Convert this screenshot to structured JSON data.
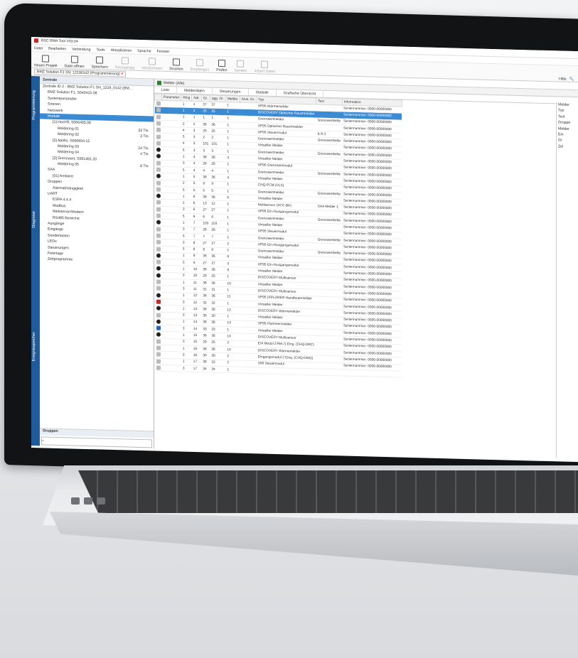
{
  "app": {
    "title": "BSC BMA Tool V03.04"
  },
  "menu": [
    "Datei",
    "Bearbeiten",
    "Verbindung",
    "Tools",
    "Aktualisieren",
    "Sprache",
    "Fenster"
  ],
  "toolbar": [
    {
      "label": "Neues Projekt",
      "enabled": true
    },
    {
      "label": "Datei öffnen",
      "enabled": true
    },
    {
      "label": "Speichern",
      "enabled": true
    },
    {
      "label": "Rückgängig",
      "enabled": false
    },
    {
      "label": "Wiederholen",
      "enabled": false
    },
    {
      "label": "Drucken",
      "enabled": true
    },
    {
      "label": "Empfangen",
      "enabled": false
    },
    {
      "label": "Prüfen",
      "enabled": true
    },
    {
      "label": "Senden",
      "enabled": false
    },
    {
      "label": "Import Daten",
      "enabled": false
    }
  ],
  "toolbar_right": {
    "help_label": "Hilfe",
    "search_icon": "search-icon"
  },
  "project_tab": {
    "label": "BMZ Solution F1 SN: 12190142 (Programmierung)"
  },
  "side_tabs": [
    "Programmierung",
    "Diagnose",
    "Ereignisspeicher"
  ],
  "tree": {
    "header": "Zentrale",
    "nodes": [
      {
        "label": "Zentrale ID 2 - BMZ Solution F1 SN_1219_0142 (BM...",
        "indent": 0,
        "count": ""
      },
      {
        "label": "BMZ Solution F1, S040415.08",
        "indent": 1,
        "count": ""
      },
      {
        "label": "Systemparameter",
        "indent": 1,
        "count": ""
      },
      {
        "label": "Sirenen",
        "indent": 1,
        "count": ""
      },
      {
        "label": "Netzwerk",
        "indent": 1,
        "count": ""
      },
      {
        "label": "Module",
        "indent": 1,
        "count": "",
        "selected": true
      },
      {
        "label": "[1] Hochfil, S066405.08",
        "indent": 2,
        "count": ""
      },
      {
        "label": "Meldering 01",
        "indent": 3,
        "count": "33 Tln."
      },
      {
        "label": "Meldering 02",
        "indent": 3,
        "count": "3 Tln."
      },
      {
        "label": "[2] Apollo, S060604.15",
        "indent": 2,
        "count": ""
      },
      {
        "label": "Meldering 03",
        "indent": 3,
        "count": "24 Tln."
      },
      {
        "label": "Meldering 04",
        "indent": 3,
        "count": "4 Tln."
      },
      {
        "label": "[3] Grenzwert, S061481.20",
        "indent": 2,
        "count": ""
      },
      {
        "label": "Meldering 05",
        "indent": 3,
        "count": "8 Tln."
      },
      {
        "label": "SAA",
        "indent": 1,
        "count": ""
      },
      {
        "label": "[01] Ambient",
        "indent": 2,
        "count": ""
      },
      {
        "label": "Gruppen",
        "indent": 1,
        "count": ""
      },
      {
        "label": "Alarmabhängigkeit",
        "indent": 2,
        "count": ""
      },
      {
        "label": "UART",
        "indent": 1,
        "count": ""
      },
      {
        "label": "ESPA 4.4.4",
        "indent": 2,
        "count": ""
      },
      {
        "label": "Modbus",
        "indent": 2,
        "count": ""
      },
      {
        "label": "Webserver/Modem",
        "indent": 2,
        "count": ""
      },
      {
        "label": "RS485 Bereiche",
        "indent": 2,
        "count": ""
      },
      {
        "label": "Ausgänge",
        "indent": 1,
        "count": ""
      },
      {
        "label": "Eingänge",
        "indent": 1,
        "count": ""
      },
      {
        "label": "Sondertasten",
        "indent": 1,
        "count": ""
      },
      {
        "label": "LEDs",
        "indent": 1,
        "count": ""
      },
      {
        "label": "Steuerungen",
        "indent": 1,
        "count": ""
      },
      {
        "label": "Feiertage",
        "indent": 1,
        "count": ""
      },
      {
        "label": "Zeitprogramme",
        "indent": 1,
        "count": ""
      }
    ],
    "footer": "Gruppen"
  },
  "grid": {
    "title": "Melder (Alle)",
    "tabs": [
      "Liste",
      "Melderdaten",
      "Steuerungen",
      "Statistik",
      "Grafische Übersicht"
    ],
    "columns": [
      "Parameter",
      "Ring",
      "Adr.",
      "Gr.",
      "agg. Gr.",
      "Melder",
      "Anst. Gr.",
      "Typ",
      "Text",
      "Information"
    ],
    "rows": [
      {
        "icon": "grey",
        "ring": "1",
        "adr": "1",
        "gr": "37",
        "agg": "37",
        "melder": "1",
        "anst": "",
        "typ": "XP95 Wärmemelder",
        "text": "",
        "info": "Seriennummer: 0000-00000000"
      },
      {
        "icon": "grey",
        "ring": "1",
        "adr": "2",
        "gr": "25",
        "agg": "25",
        "melder": "1",
        "anst": "",
        "typ": "DISCOVERY Optischer Rauchmelder",
        "text": "",
        "info": "Seriennummer: 0000-00000000",
        "selected": true
      },
      {
        "icon": "grey",
        "ring": "1",
        "adr": "1",
        "gr": "1",
        "agg": "1",
        "melder": "1",
        "anst": "",
        "typ": "Grenzwertmelder",
        "text": "Grenzwertkette",
        "info": "Seriennummer: 0000-00000000"
      },
      {
        "icon": "grey",
        "ring": "2",
        "adr": "2",
        "gr": "36",
        "agg": "36",
        "melder": "1",
        "anst": "",
        "typ": "XP95 Optischer Rauchmelder",
        "text": "",
        "info": "Seriennummer: 0000-00000000"
      },
      {
        "icon": "grey",
        "ring": "4",
        "adr": "3",
        "gr": "25",
        "agg": "25",
        "melder": "1",
        "anst": "",
        "typ": "XP95 Steuermodul",
        "text": "& N 2",
        "info": "Seriennummer: 0000-00000000"
      },
      {
        "icon": "grey",
        "ring": "5",
        "adr": "3",
        "gr": "2",
        "agg": "2",
        "melder": "1",
        "anst": "",
        "typ": "Grenzwertmelder",
        "text": "Grenzwertkette",
        "info": "Seriennummer: 0000-00000000"
      },
      {
        "icon": "grey",
        "ring": "4",
        "adr": "3",
        "gr": "101",
        "agg": "101",
        "melder": "1",
        "anst": "",
        "typ": "Virtueller Melder",
        "text": "",
        "info": "Seriennummer: 0000-00000000"
      },
      {
        "icon": "black",
        "ring": "5",
        "adr": "3",
        "gr": "3",
        "agg": "3",
        "melder": "1",
        "anst": "",
        "typ": "Grenzwertmelder",
        "text": "Grenzwertkette",
        "info": "Seriennummer: 0000-00000000"
      },
      {
        "icon": "black",
        "ring": "1",
        "adr": "4",
        "gr": "36",
        "agg": "36",
        "melder": "3",
        "anst": "",
        "typ": "Virtueller Melder",
        "text": "",
        "info": "Seriennummer: 0000-00000000"
      },
      {
        "icon": "grey",
        "ring": "3",
        "adr": "4",
        "gr": "26",
        "agg": "26",
        "melder": "1",
        "anst": "",
        "typ": "XP95 Grenzwertmodul",
        "text": "",
        "info": "Seriennummer: 0000-00000000"
      },
      {
        "icon": "grey",
        "ring": "5",
        "adr": "4",
        "gr": "4",
        "agg": "4",
        "melder": "1",
        "anst": "",
        "typ": "Grenzwertmelder",
        "text": "Grenzwertkette",
        "info": "Seriennummer: 0000-00000000"
      },
      {
        "icon": "black",
        "ring": "1",
        "adr": "5",
        "gr": "36",
        "agg": "36",
        "melder": "4",
        "anst": "",
        "typ": "Virtueller Melder",
        "text": "",
        "info": "Seriennummer: 0000-00000000"
      },
      {
        "icon": "grey",
        "ring": "2",
        "adr": "5",
        "gr": "9",
        "agg": "9",
        "melder": "1",
        "anst": "",
        "typ": "CHQ-PCM (VLS)",
        "text": "",
        "info": "Seriennummer: 0000-00000000"
      },
      {
        "icon": "grey",
        "ring": "5",
        "adr": "5",
        "gr": "5",
        "agg": "5",
        "melder": "1",
        "anst": "",
        "typ": "Grenzwertmelder",
        "text": "Grenzwertkette",
        "info": "Seriennummer: 0000-00000000"
      },
      {
        "icon": "black",
        "ring": "1",
        "adr": "6",
        "gr": "36",
        "agg": "36",
        "melder": "5",
        "anst": "",
        "typ": "Virtueller Melder",
        "text": "",
        "info": "Seriennummer: 0000-00000000"
      },
      {
        "icon": "grey",
        "ring": "2",
        "adr": "6",
        "gr": "13",
        "agg": "12",
        "melder": "1",
        "anst": "",
        "typ": "Multisensor (XCC-BK)",
        "text": "SAA Melder 1",
        "info": "Seriennummer: 0000-00000000"
      },
      {
        "icon": "grey",
        "ring": "3",
        "adr": "6",
        "gr": "27",
        "agg": "27",
        "melder": "1",
        "anst": "",
        "typ": "XP95 Ein-/Ausgangsmodul",
        "text": "",
        "info": "Seriennummer: 0000-00000000"
      },
      {
        "icon": "grey",
        "ring": "5",
        "adr": "6",
        "gr": "6",
        "agg": "6",
        "melder": "1",
        "anst": "",
        "typ": "Grenzwertmelder",
        "text": "Grenzwertkette",
        "info": "Seriennummer: 0000-00000000"
      },
      {
        "icon": "black",
        "ring": "1",
        "adr": "7",
        "gr": "103",
        "agg": "103",
        "melder": "1",
        "anst": "",
        "typ": "Virtueller Melder",
        "text": "",
        "info": "Seriennummer: 0000-00000000"
      },
      {
        "icon": "grey",
        "ring": "3",
        "adr": "7",
        "gr": "28",
        "agg": "28",
        "melder": "1",
        "anst": "",
        "typ": "XP95 Steuermodul",
        "text": "",
        "info": "Seriennummer: 0000-00000000"
      },
      {
        "icon": "grey",
        "ring": "5",
        "adr": "7",
        "gr": "7",
        "agg": "7",
        "melder": "1",
        "anst": "",
        "typ": "Grenzwertmelder",
        "text": "Grenzwertkette",
        "info": "Seriennummer: 0000-00000000"
      },
      {
        "icon": "grey",
        "ring": "3",
        "adr": "8",
        "gr": "27",
        "agg": "27",
        "melder": "2",
        "anst": "",
        "typ": "XP95 Ein-/Ausgangsmodul",
        "text": "",
        "info": "Seriennummer: 0000-00000000"
      },
      {
        "icon": "grey",
        "ring": "5",
        "adr": "8",
        "gr": "8",
        "agg": "8",
        "melder": "1",
        "anst": "",
        "typ": "Grenzwertmelder",
        "text": "Grenzwertkette",
        "info": "Seriennummer: 0000-00000000"
      },
      {
        "icon": "black",
        "ring": "1",
        "adr": "9",
        "gr": "36",
        "agg": "36",
        "melder": "6",
        "anst": "",
        "typ": "Virtueller Melder",
        "text": "",
        "info": "Seriennummer: 0000-00000000"
      },
      {
        "icon": "grey",
        "ring": "3",
        "adr": "9",
        "gr": "27",
        "agg": "27",
        "melder": "3",
        "anst": "",
        "typ": "XP95 Ein-/Ausgangsmodul",
        "text": "",
        "info": "Seriennummer: 0000-00000000"
      },
      {
        "icon": "black",
        "ring": "1",
        "adr": "10",
        "gr": "36",
        "agg": "36",
        "melder": "9",
        "anst": "",
        "typ": "Virtueller Melder",
        "text": "",
        "info": "Seriennummer: 0000-00000000"
      },
      {
        "icon": "black",
        "ring": "3",
        "adr": "10",
        "gr": "29",
        "agg": "25",
        "melder": "1",
        "anst": "",
        "typ": "DISCOVERY Multisensor",
        "text": "",
        "info": "Seriennummer: 0000-00000000"
      },
      {
        "icon": "grey",
        "ring": "1",
        "adr": "11",
        "gr": "36",
        "agg": "36",
        "melder": "10",
        "anst": "",
        "typ": "Virtueller Melder",
        "text": "",
        "info": "Seriennummer: 0000-00000000"
      },
      {
        "icon": "grey",
        "ring": "3",
        "adr": "11",
        "gr": "31",
        "agg": "31",
        "melder": "1",
        "anst": "",
        "typ": "DISCOVERY Multisensor",
        "text": "",
        "info": "Seriennummer: 0000-00000000"
      },
      {
        "icon": "black",
        "ring": "1",
        "adr": "12",
        "gr": "36",
        "agg": "36",
        "melder": "11",
        "anst": "",
        "typ": "XP95 (XPLORER Handfeuermelder",
        "text": "",
        "info": "Seriennummer: 0000-00000000"
      },
      {
        "icon": "red",
        "ring": "3",
        "adr": "12",
        "gr": "32",
        "agg": "32",
        "melder": "1",
        "anst": "",
        "typ": "Virtueller Melder",
        "text": "",
        "info": "Seriennummer: 0000-00000000"
      },
      {
        "icon": "black",
        "ring": "1",
        "adr": "13",
        "gr": "36",
        "agg": "36",
        "melder": "12",
        "anst": "",
        "typ": "DISCOVERY Wärmemelder",
        "text": "",
        "info": "Seriennummer: 0000-00000000"
      },
      {
        "icon": "grey",
        "ring": "3",
        "adr": "13",
        "gr": "30",
        "agg": "30",
        "melder": "1",
        "anst": "",
        "typ": "Virtueller Melder",
        "text": "",
        "info": "Seriennummer: 0000-00000000"
      },
      {
        "icon": "black",
        "ring": "1",
        "adr": "14",
        "gr": "36",
        "agg": "36",
        "melder": "13",
        "anst": "",
        "typ": "XP95 Flammenmelder",
        "text": "",
        "info": "Seriennummer: 0000-00000000"
      },
      {
        "icon": "blue",
        "ring": "3",
        "adr": "14",
        "gr": "33",
        "agg": "33",
        "melder": "1",
        "anst": "",
        "typ": "Virtueller Melder",
        "text": "",
        "info": "Seriennummer: 0000-00000000"
      },
      {
        "icon": "black",
        "ring": "1",
        "adr": "15",
        "gr": "36",
        "agg": "36",
        "melder": "14",
        "anst": "",
        "typ": "DISCOVERY Multisensor",
        "text": "",
        "info": "Seriennummer: 0000-00000000"
      },
      {
        "icon": "grey",
        "ring": "3",
        "adr": "15",
        "gr": "29",
        "agg": "25",
        "melder": "2",
        "anst": "",
        "typ": "E/A Modul 3 Rel./1 Eing. (CHQ-DRC)",
        "text": "",
        "info": "Seriennummer: 0000-00000000"
      },
      {
        "icon": "grey",
        "ring": "1",
        "adr": "16",
        "gr": "36",
        "agg": "36",
        "melder": "15",
        "anst": "",
        "typ": "DISCOVERY Wärmemelder",
        "text": "",
        "info": "Seriennummer: 0000-00000000"
      },
      {
        "icon": "grey",
        "ring": "3",
        "adr": "16",
        "gr": "30",
        "agg": "30",
        "melder": "2",
        "anst": "",
        "typ": "Eingangsmodul 2 Eing. (CHQ-DIM2)",
        "text": "",
        "info": "Seriennummer: 0000-00000000"
      },
      {
        "icon": "grey",
        "ring": "1",
        "adr": "17",
        "gr": "36",
        "agg": "15",
        "melder": "2",
        "anst": "",
        "typ": "S90 Steuermodul",
        "text": "",
        "info": "Seriennummer: 0000-00000000"
      },
      {
        "icon": "grey",
        "ring": "3",
        "adr": "17",
        "gr": "34",
        "agg": "34",
        "melder": "1",
        "anst": "",
        "typ": "",
        "text": "",
        "info": ""
      }
    ]
  },
  "props": [
    "Melder",
    "Typ",
    "Text",
    "Gruppe",
    "Melder",
    "Ein",
    "Gr",
    "Zei"
  ]
}
